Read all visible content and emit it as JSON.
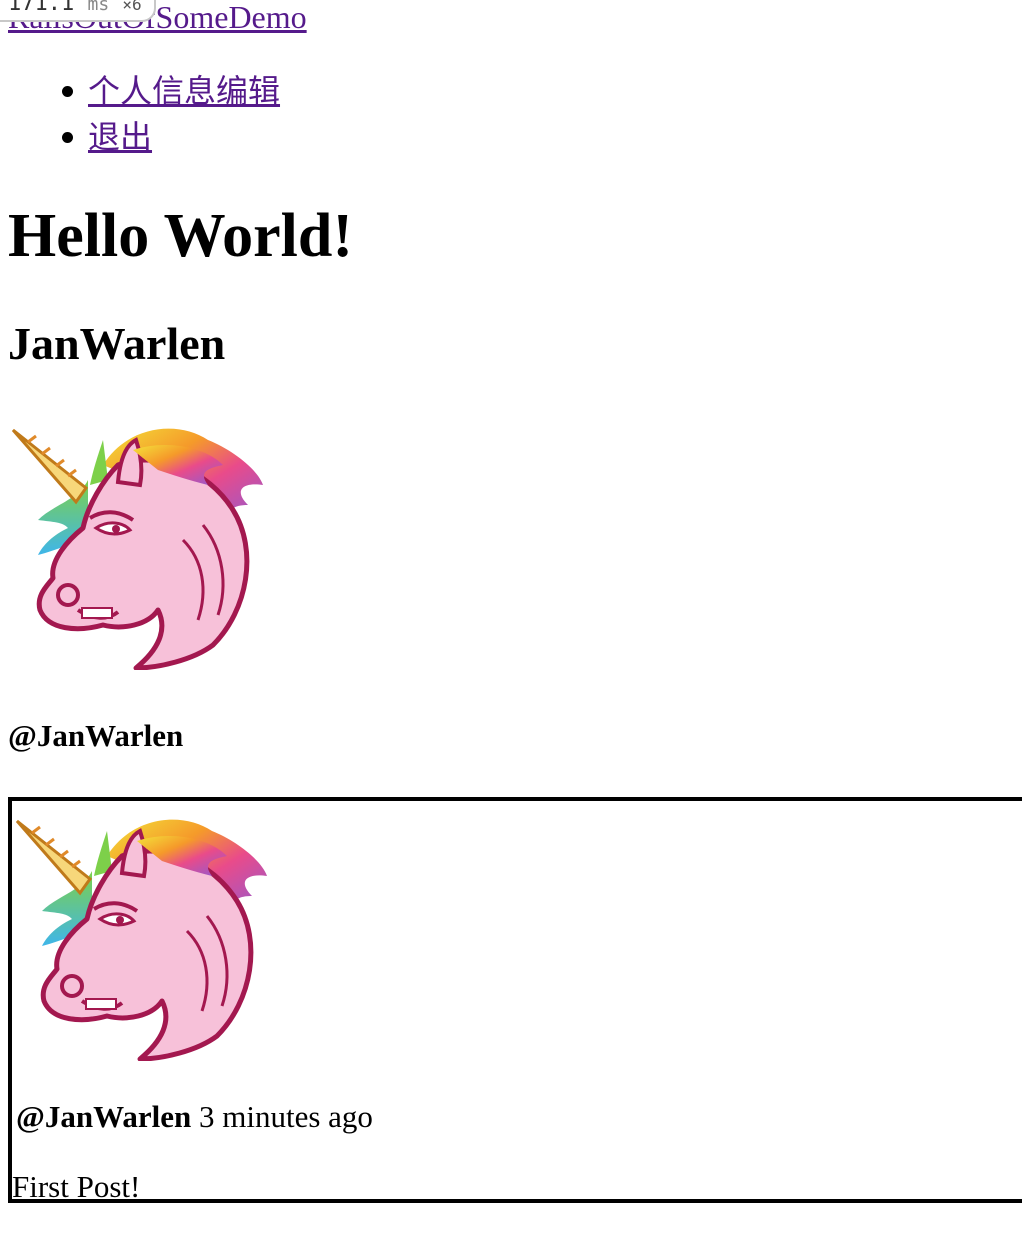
{
  "profiler": {
    "time": "171.1",
    "unit": "ms",
    "count": "×6"
  },
  "site": {
    "title": "RailsOutOfSomeDemo"
  },
  "nav": {
    "items": [
      {
        "label": "个人信息编辑"
      },
      {
        "label": "退出"
      }
    ]
  },
  "main": {
    "heading": "Hello World!",
    "user_name": "JanWarlen",
    "user_handle": "@JanWarlen",
    "avatar_icon": "unicorn-avatar"
  },
  "posts": [
    {
      "author": "@JanWarlen",
      "time_ago": "3 minutes ago",
      "content": "First Post!"
    }
  ],
  "colors": {
    "link_visited": "#551a8b",
    "unicorn_pink": "#f7c1d9",
    "unicorn_outline": "#a3184f"
  }
}
